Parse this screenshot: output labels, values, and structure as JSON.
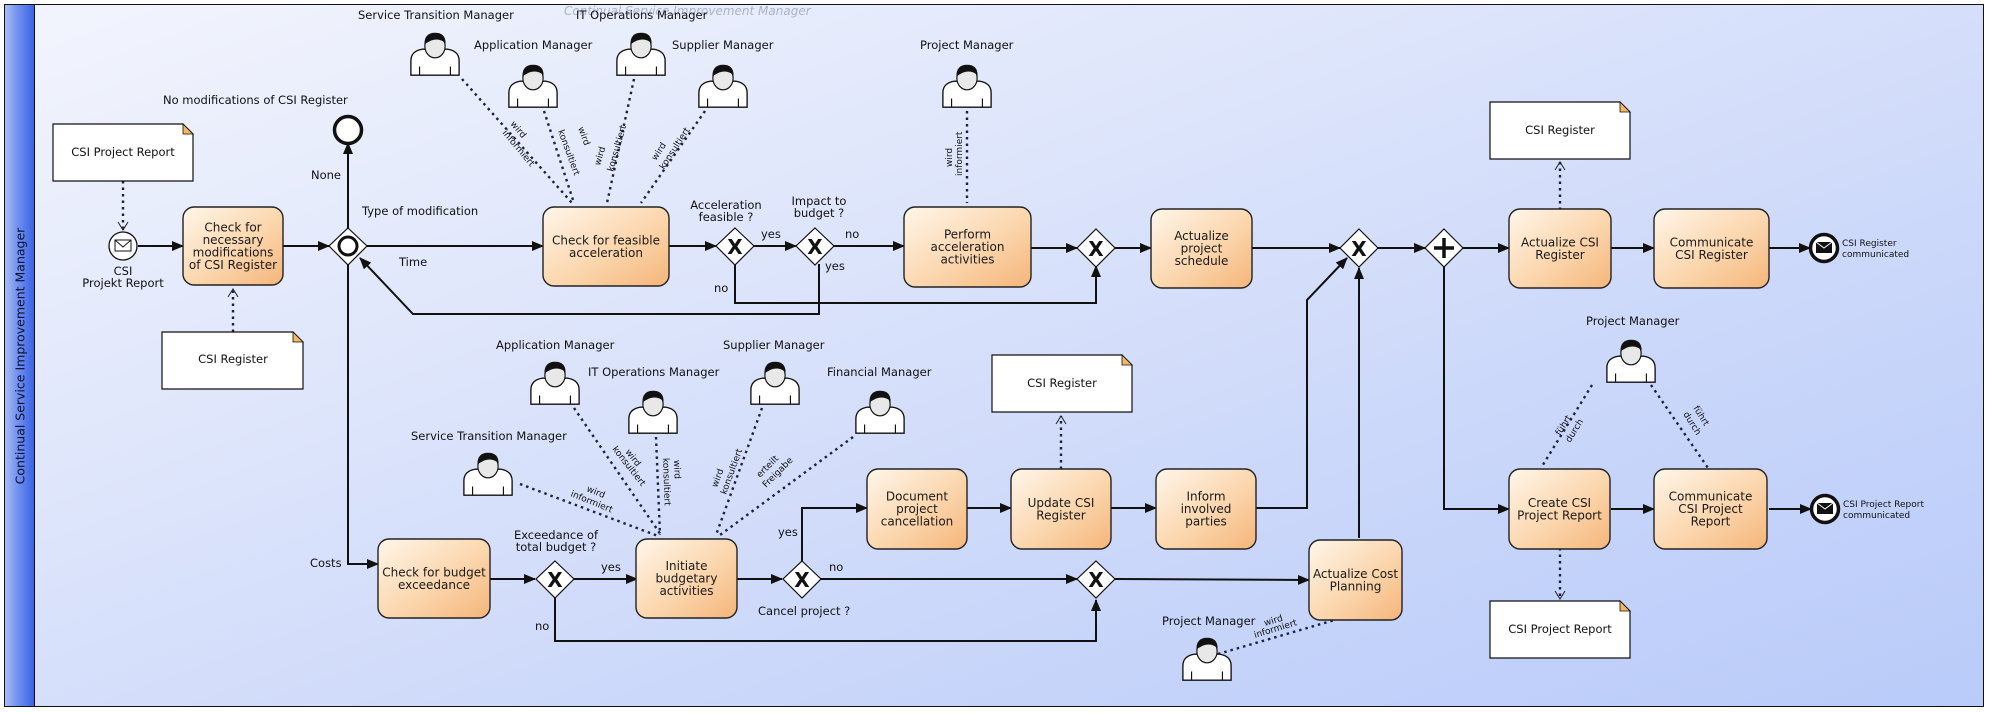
{
  "pool": {
    "lane_label": "Continual Service Improvement Manager",
    "watermark": "Continual Service Improvement Manager"
  },
  "colors": {
    "task_fill_light": "#fff4e6",
    "task_fill_dark": "#f8c48e",
    "pool_header": "#4f75ea",
    "pool_background": "#d6e0fb",
    "data_object_corner": "#f4b860"
  },
  "start_event": {
    "label_line1": "CSI",
    "label_line2": "Projekt Report",
    "icon": "envelope-icon"
  },
  "end_events": [
    {
      "id": "none-end",
      "label": "None"
    },
    {
      "id": "csi-register-communicated",
      "label_line1": "CSI Register",
      "label_line2": "communicated",
      "icon": "envelope-filled-icon"
    },
    {
      "id": "csi-project-report-communicated",
      "label_line1": "CSI Project Report",
      "label_line2": "communicated",
      "icon": "envelope-filled-icon"
    }
  ],
  "annotations": {
    "no_modifications": "No modifications of CSI Register",
    "type_of_modification": "Type of modification",
    "time": "Time",
    "costs": "Costs",
    "acceleration_feasible": [
      "Acceleration",
      "feasible ?"
    ],
    "impact_to_budget": [
      "Impact to",
      "budget ?"
    ],
    "exceedance_total_budget": [
      "Exceedance of",
      "total budget ?"
    ],
    "cancel_project": "Cancel project ?",
    "yes": "yes",
    "no": "no"
  },
  "tasks": [
    {
      "id": "check-modifications",
      "lines": [
        "Check for",
        "necessary",
        "modifications",
        "of CSI Register"
      ]
    },
    {
      "id": "check-acceleration",
      "lines": [
        "Check for feasible",
        "acceleration"
      ]
    },
    {
      "id": "perform-acceleration",
      "lines": [
        "Perform",
        "acceleration",
        "activities"
      ]
    },
    {
      "id": "actualize-schedule",
      "lines": [
        "Actualize",
        "project",
        "schedule"
      ]
    },
    {
      "id": "actualize-csi-register",
      "lines": [
        "Actualize CSI",
        "Register"
      ]
    },
    {
      "id": "communicate-csi-register",
      "lines": [
        "Communicate",
        "CSI Register"
      ]
    },
    {
      "id": "check-budget",
      "lines": [
        "Check for budget",
        "exceedance"
      ]
    },
    {
      "id": "initiate-budgetary",
      "lines": [
        "Initiate",
        "budgetary",
        "activities"
      ]
    },
    {
      "id": "document-cancellation",
      "lines": [
        "Document",
        "project",
        "cancellation"
      ]
    },
    {
      "id": "update-csi-register",
      "lines": [
        "Update CSI",
        "Register"
      ]
    },
    {
      "id": "inform-parties",
      "lines": [
        "Inform",
        "involved",
        "parties"
      ]
    },
    {
      "id": "actualize-cost",
      "lines": [
        "Actualize Cost",
        "Planning"
      ]
    },
    {
      "id": "create-report",
      "lines": [
        "Create CSI",
        "Project Report"
      ]
    },
    {
      "id": "communicate-report",
      "lines": [
        "Communicate",
        "CSI Project",
        "Report"
      ]
    }
  ],
  "data_objects": [
    {
      "id": "csi-project-report-in",
      "label": "CSI Project Report"
    },
    {
      "id": "csi-register-in",
      "label": "CSI Register"
    },
    {
      "id": "csi-register-out-top",
      "label": "CSI Register"
    },
    {
      "id": "csi-register-out-mid",
      "label": "CSI Register"
    },
    {
      "id": "csi-project-report-out",
      "label": "CSI Project Report"
    }
  ],
  "roles": [
    {
      "id": "r1",
      "label": "Service Transition Manager",
      "relation": [
        "wird",
        "informiert"
      ]
    },
    {
      "id": "r2",
      "label": "Application Manager",
      "relation": [
        "wird",
        "konsultiert"
      ]
    },
    {
      "id": "r3",
      "label": "IT Operations Manager",
      "relation": [
        "wird",
        "konsultiert"
      ]
    },
    {
      "id": "r4",
      "label": "Supplier Manager",
      "relation": [
        "wird",
        "konsultiert"
      ]
    },
    {
      "id": "r5",
      "label": "Project Manager",
      "relation": [
        "wird",
        "informiert"
      ]
    },
    {
      "id": "r6",
      "label": "Application Manager",
      "relation": [
        "wird",
        "konsultiert"
      ]
    },
    {
      "id": "r7",
      "label": "IT Operations Manager",
      "relation": [
        "wird",
        "konsultiert"
      ]
    },
    {
      "id": "r8",
      "label": "Supplier Manager",
      "relation": [
        "wird",
        "konsultiert"
      ]
    },
    {
      "id": "r9",
      "label": "Financial Manager",
      "relation": [
        "erteilt",
        "Freigabe"
      ]
    },
    {
      "id": "r10",
      "label": "Service Transition Manager",
      "relation": [
        "wird",
        "informiert"
      ]
    },
    {
      "id": "r11",
      "label": "Project Manager",
      "relation": [
        "führt",
        "durch"
      ],
      "relation2": [
        "führt",
        "durch"
      ]
    },
    {
      "id": "r12",
      "label": "Project Manager",
      "relation": [
        "wird",
        "informiert"
      ]
    }
  ]
}
